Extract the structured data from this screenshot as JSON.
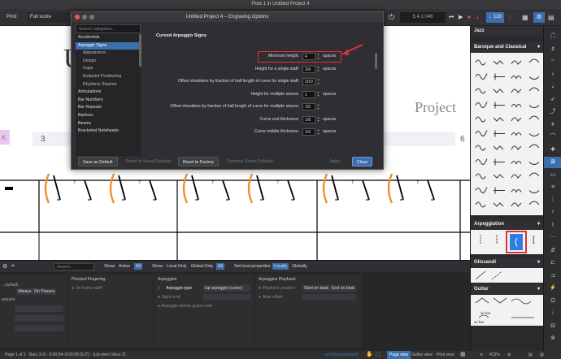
{
  "window": {
    "title": "Flow 1 in Untitled Project 4"
  },
  "toolbar": {
    "print_label": "Print",
    "layout_select": "Full score",
    "version": "5.4.1.046",
    "tempo": "120"
  },
  "score": {
    "title_fragment": "U",
    "composer_fragment": "Project",
    "bar_numbers": [
      "3",
      "6"
    ]
  },
  "dialog": {
    "title": "Untitled Project 4 – Engraving Options",
    "search_placeholder": "Search categories...",
    "categories": [
      {
        "label": "Accidentals",
        "sub": false,
        "selected": false
      },
      {
        "label": "Arpeggio Signs",
        "sub": false,
        "selected": true
      },
      {
        "label": "Appearance",
        "sub": true,
        "selected": false
      },
      {
        "label": "Design",
        "sub": true,
        "selected": false
      },
      {
        "label": "Gaps",
        "sub": true,
        "selected": false
      },
      {
        "label": "Endpoint Positioning",
        "sub": true,
        "selected": false
      },
      {
        "label": "Rhythmic Slashes",
        "sub": true,
        "selected": false
      },
      {
        "label": "Articulations",
        "sub": false,
        "selected": false
      },
      {
        "label": "Bar Numbers",
        "sub": false,
        "selected": false
      },
      {
        "label": "Bar Repeats",
        "sub": false,
        "selected": false
      },
      {
        "label": "Barlines",
        "sub": false,
        "selected": false
      },
      {
        "label": "Beams",
        "sub": false,
        "selected": false
      },
      {
        "label": "Bracketed Noteheads",
        "sub": false,
        "selected": false
      }
    ],
    "section_heading": "Curved Arpeggio Signs",
    "options": [
      {
        "label": "Minimum length:",
        "value": "4",
        "unit": "spaces"
      },
      {
        "label": "Height for a single staff:",
        "value": "3/4",
        "unit": "spaces"
      },
      {
        "label": "Offset shoulders by fraction of half length of curve for single staff:",
        "value": "3/10",
        "unit": ""
      },
      {
        "label": "Height for multiple staves:",
        "value": "1",
        "unit": "spaces"
      },
      {
        "label": "Offset shoulders by fraction of half length of curve for multiple staves:",
        "value": "1/5",
        "unit": ""
      },
      {
        "label": "Curve end thickness:",
        "value": "1/8",
        "unit": "spaces"
      },
      {
        "label": "Curve middle thickness:",
        "value": "1/4",
        "unit": "spaces"
      }
    ],
    "buttons": {
      "save_default": "Save as Default",
      "reset_saved": "Reset to Saved Defaults",
      "reset_factory": "Reset to Factory",
      "remove_saved": "Remove Saved Defaults",
      "apply": "Apply",
      "close": "Close"
    }
  },
  "right_panel": {
    "top_label": "Jazz",
    "sections": {
      "baroque": "Baroque and Classical",
      "arpeggiation": "Arpeggiation",
      "glissandi": "Glissandi",
      "guitar": "Guitar"
    },
    "guitar_labels": [
      "w/ bar",
      "w/ bar"
    ]
  },
  "bottom_panel": {
    "search_placeholder": "Search...",
    "show1_label": "Show:",
    "show1_active": "Active",
    "show1_all": "All",
    "show2_label": "Show:",
    "show2_local": "Local Only",
    "show2_global": "Global Only",
    "show2_all": "All",
    "set_local_label": "Set local properties:",
    "set_local_locally": "Locally",
    "set_local_globally": "Globally",
    "col0": {
      "title": "...ayback",
      "always": "Always",
      "on_passes": "On Passes",
      "passes": "passes"
    },
    "col1": {
      "title": "Plucked Fingering",
      "on_home": "On home staff"
    },
    "col2": {
      "title": "Arpeggios",
      "type_label": "Arpeggio type",
      "type_value": "Up arpeggio (curve)",
      "signs_end": "Signs end",
      "before_grace": "Arpeggio before grace note"
    },
    "col3": {
      "title": "Arpeggios Playback",
      "playback_position": "Playback position",
      "start_on_beat": "Start on beat",
      "end_on_beat": "End on beat",
      "note_offset": "Note offset"
    }
  },
  "status_bar": {
    "left": "Page 1 of 1 · Bars 3–5 · 0:00:04–0:00:09 (5.0\") · (Up-stem Voice 2)",
    "follow": "Follow playhead",
    "page_view": "Page view",
    "galley_view": "Galley view",
    "print_view": "Print view",
    "zoom": "413%"
  },
  "colors": {
    "accent": "#3b6fae",
    "annotation_red": "#e0303a",
    "arpeggio_orange": "#f0902a"
  }
}
